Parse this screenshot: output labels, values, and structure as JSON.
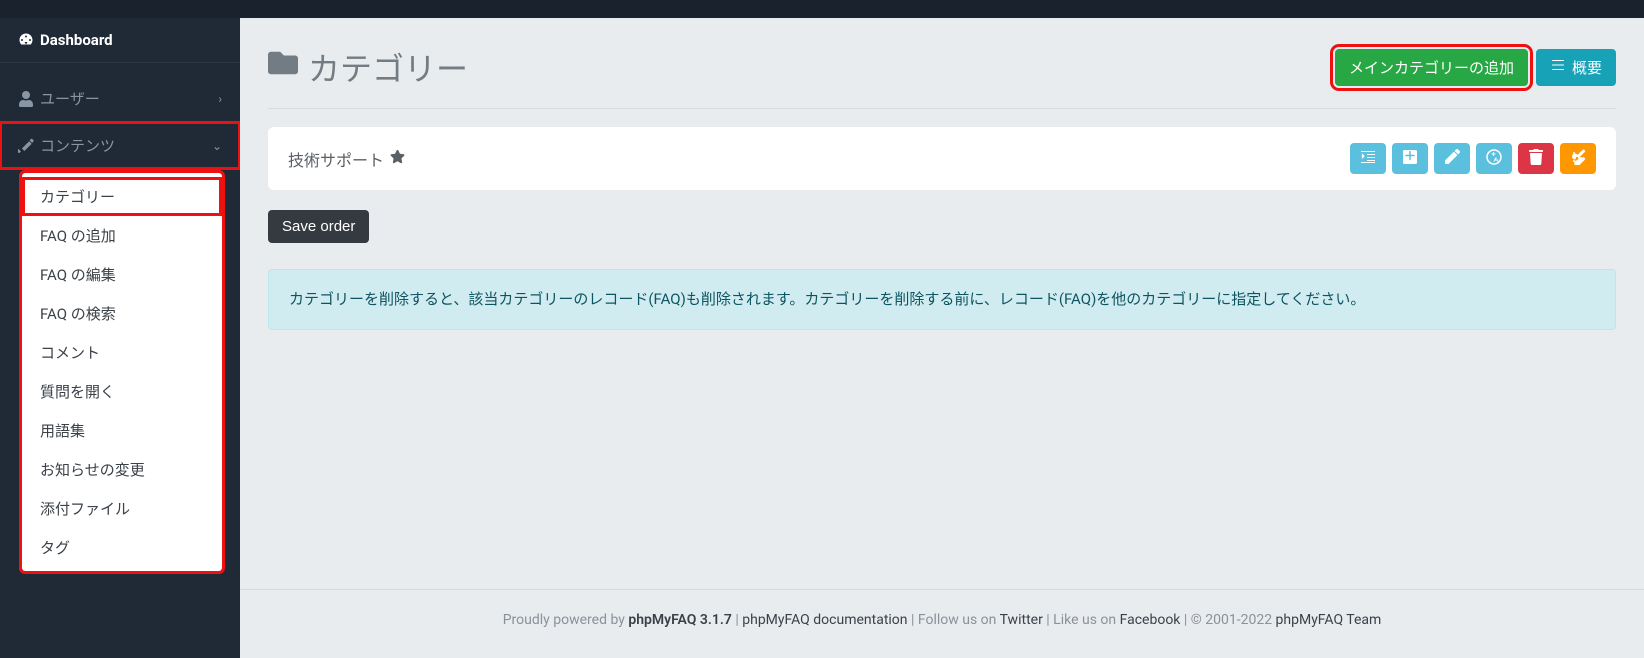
{
  "sidebar": {
    "dashboard": "Dashboard",
    "users": "ユーザー",
    "contents": "コンテンツ",
    "submenu": [
      "カテゴリー",
      "FAQ の追加",
      "FAQ の編集",
      "FAQ の検索",
      "コメント",
      "質問を開く",
      "用語集",
      "お知らせの変更",
      "添付ファイル",
      "タグ"
    ]
  },
  "page": {
    "title": "カテゴリー",
    "add_main_category": "メインカテゴリーの追加",
    "overview": "概要"
  },
  "category": {
    "name": "技術サポート"
  },
  "actions": {
    "save_order": "Save order"
  },
  "alert": {
    "text": "カテゴリーを削除すると、該当カテゴリーのレコード(FAQ)も削除されます。カテゴリーを削除する前に、レコード(FAQ)を他のカテゴリーに指定してください。"
  },
  "footer": {
    "powered": "Proudly powered by ",
    "product": "phpMyFAQ 3.1.7",
    "sep1": " | ",
    "docs": "phpMyFAQ documentation",
    "follow_pre": " | Follow us on ",
    "twitter": "Twitter",
    "like_pre": " | Like us on ",
    "facebook": "Facebook",
    "copy_pre": " | © 2001-2022 ",
    "team": "phpMyFAQ Team"
  }
}
